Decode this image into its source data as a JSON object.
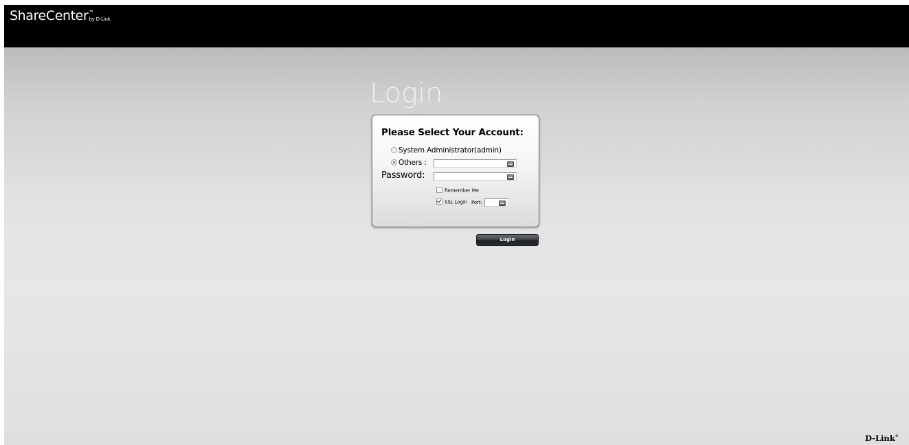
{
  "header": {
    "brand_name": "ShareCenter",
    "brand_tm": "™",
    "brand_by": "by D-Link"
  },
  "login": {
    "heading": "Login",
    "card_title": "Please Select Your Account:",
    "account_options": [
      {
        "label": "System Administrator(admin)",
        "selected": false
      },
      {
        "label": "Others :",
        "selected": true
      }
    ],
    "username_value": "",
    "password_label": "Password:",
    "password_value": "",
    "remember_me_label": "Remember Me",
    "remember_me_checked": false,
    "ssl_login_label": "SSL Login",
    "ssl_login_checked": true,
    "port_label": "Port:",
    "port_value": "",
    "login_button_label": "Login"
  },
  "footer": {
    "logo": "D-Link",
    "logo_mark": "®"
  },
  "colors": {
    "topbar": "#000000",
    "stage_top": "#b9bbbd",
    "stage_mid": "#e6e7e8",
    "button": "#2a2d31"
  }
}
